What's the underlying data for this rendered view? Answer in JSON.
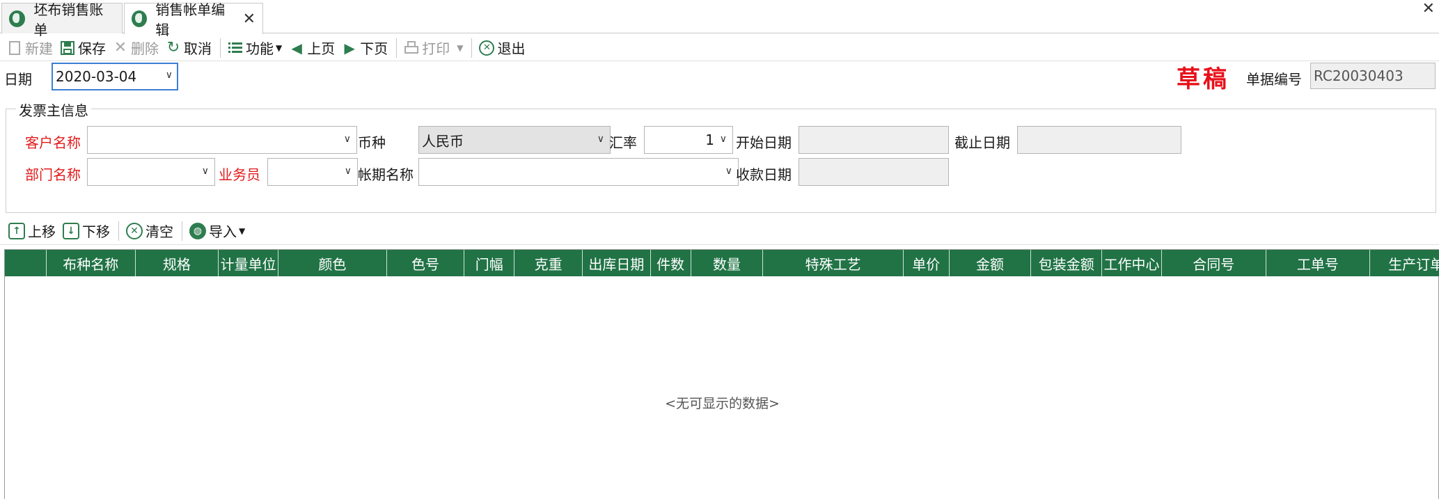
{
  "tabs": [
    {
      "label": "坯布销售账单",
      "active": false
    },
    {
      "label": "销售帐单编辑",
      "active": true
    }
  ],
  "toolbar": {
    "new": "新建",
    "save": "保存",
    "delete": "删除",
    "cancel": "取消",
    "function": "功能",
    "prev": "上页",
    "next": "下页",
    "print": "打印",
    "exit": "退出"
  },
  "header": {
    "date_label": "日期",
    "date_value": "2020-03-04",
    "draft_stamp": "草稿",
    "docno_label": "单据编号",
    "docno_value": "RC20030403"
  },
  "invoice_group": {
    "title": "发票主信息",
    "customer_label": "客户名称",
    "customer_value": "",
    "currency_label": "币种",
    "currency_value": "人民币",
    "rate_label": "汇率",
    "rate_value": "1",
    "start_date_label": "开始日期",
    "start_date_value": "",
    "end_date_label": "截止日期",
    "end_date_value": "",
    "dept_label": "部门名称",
    "dept_value": "",
    "salesman_label": "业务员",
    "salesman_value": "",
    "period_label": "帐期名称",
    "period_value": "",
    "receipt_date_label": "收款日期",
    "receipt_date_value": ""
  },
  "subbar": {
    "up": "上移",
    "down": "下移",
    "clear": "清空",
    "import": "导入"
  },
  "grid": {
    "columns": [
      "",
      "布种名称",
      "规格",
      "计量单位",
      "颜色",
      "色号",
      "门幅",
      "克重",
      "出库日期",
      "件数",
      "数量",
      "特殊工艺",
      "单价",
      "金额",
      "包装金额",
      "工作中心",
      "合同号",
      "工单号",
      "生产订单号"
    ],
    "empty_text": "<无可显示的数据>"
  },
  "colors": {
    "header_green": "#217346",
    "required_red": "#e31b1b",
    "draft_red": "#e8101a"
  }
}
